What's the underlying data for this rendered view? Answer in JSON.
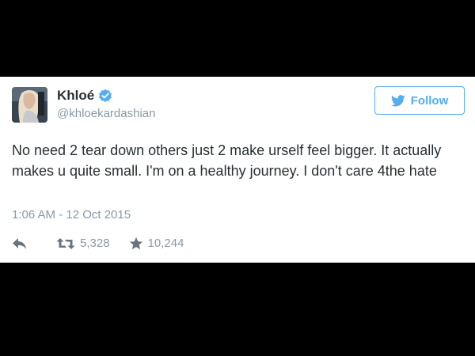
{
  "tweet": {
    "author": {
      "display_name": "Khloé",
      "handle": "@khloekardashian",
      "verified": true,
      "avatar_icon": "profile-photo"
    },
    "follow_button": {
      "label": "Follow",
      "icon": "twitter-bird-icon"
    },
    "text": "No need 2 tear down others just 2 make urself feel bigger. It actually makes u quite small. I'm on a healthy journey. I don't care 4the hate",
    "timestamp": "1:06 AM - 12 Oct 2015",
    "actions": {
      "reply_icon": "reply-icon",
      "retweet_icon": "retweet-icon",
      "retweet_count": "5,328",
      "favorite_icon": "star-icon",
      "favorite_count": "10,244"
    }
  },
  "colors": {
    "background": "#000000",
    "card": "#ffffff",
    "accent": "#55acee",
    "text": "#292f33",
    "muted": "#8899a6"
  }
}
